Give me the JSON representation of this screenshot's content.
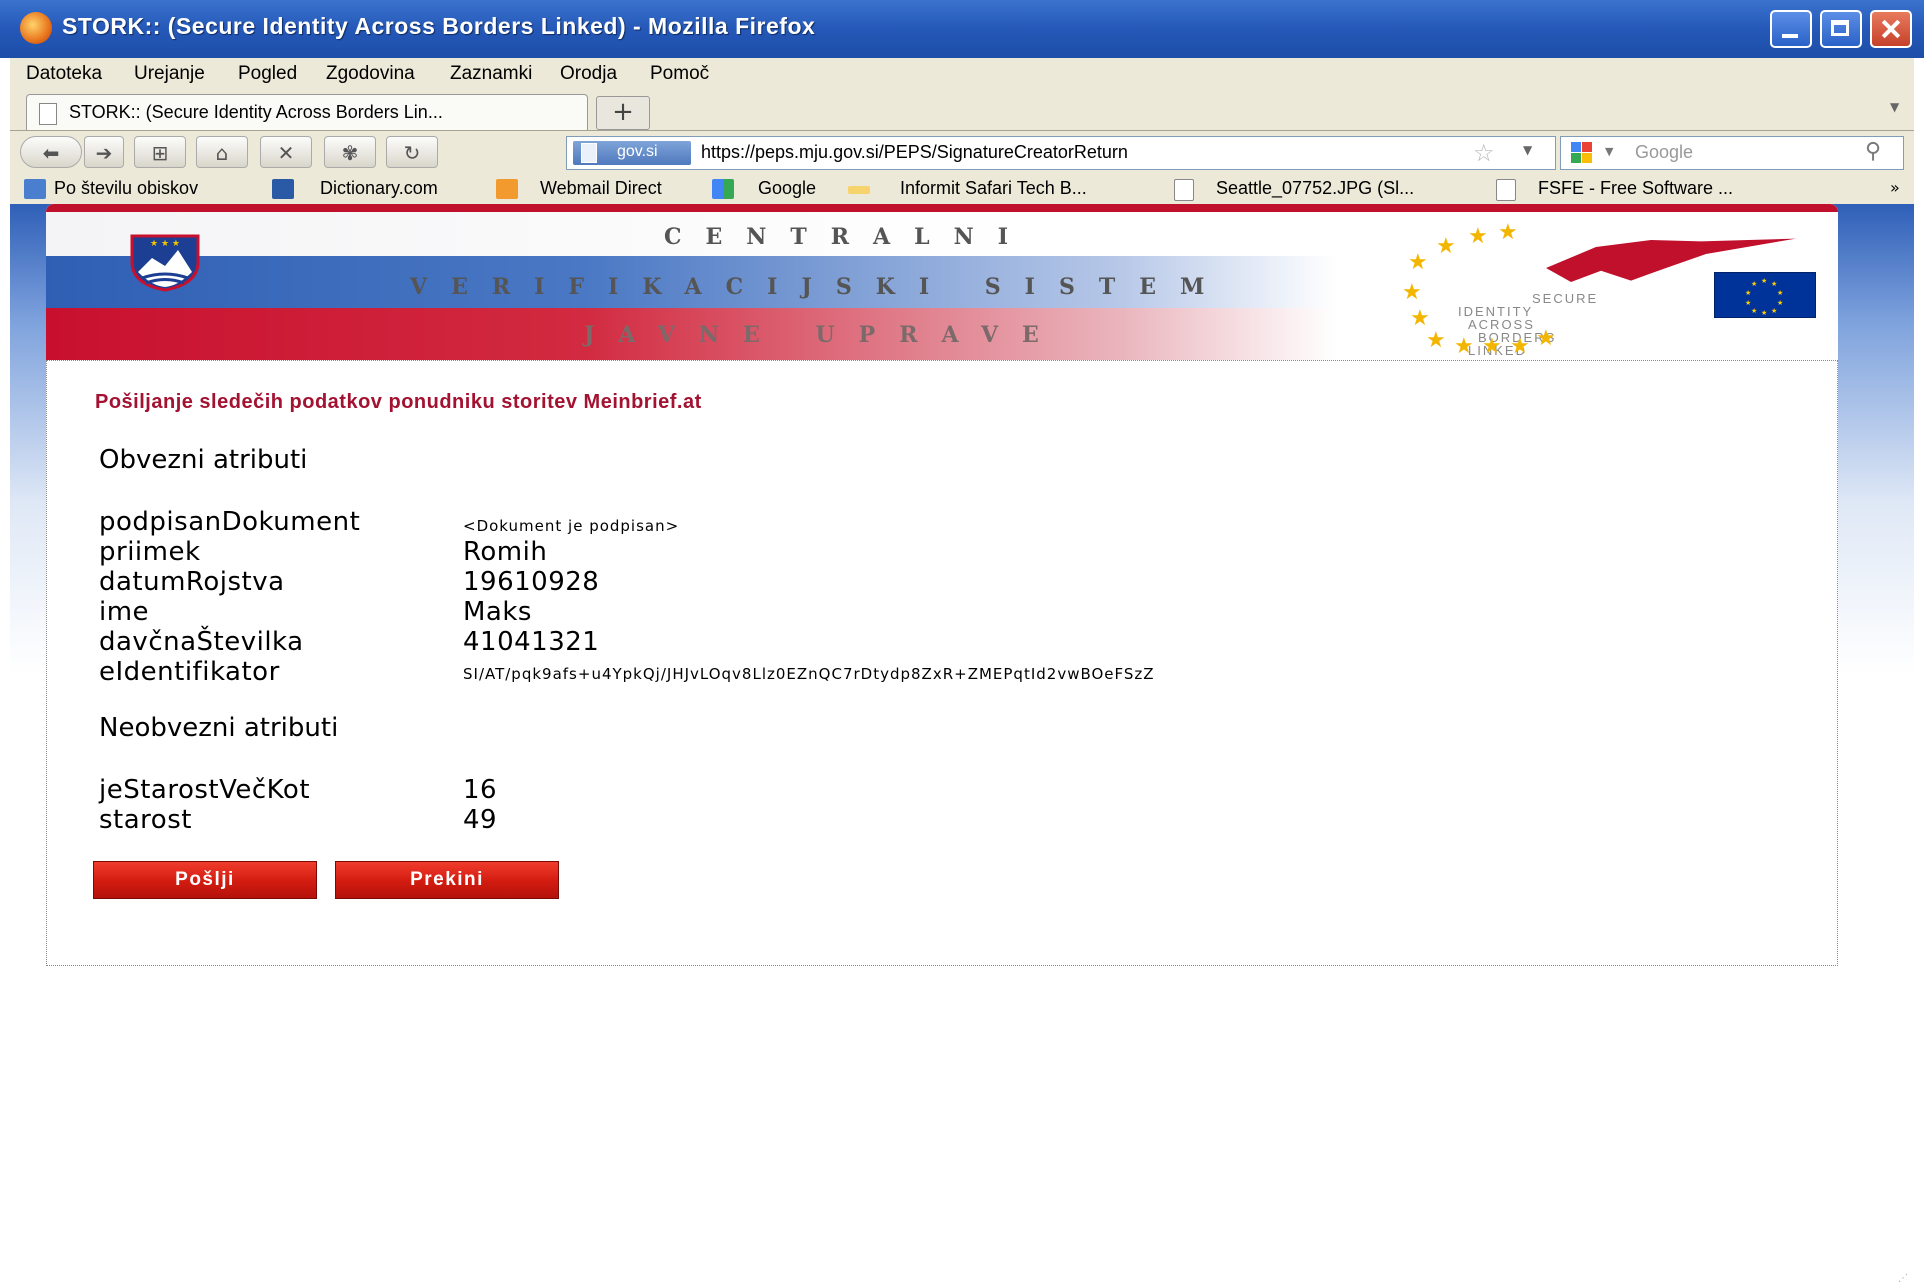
{
  "window": {
    "title": "STORK:: (Secure Identity Across Borders Linked) - Mozilla Firefox"
  },
  "menubar": [
    "Datoteka",
    "Urejanje",
    "Pogled",
    "Zgodovina",
    "Zaznamki",
    "Orodja",
    "Pomoč"
  ],
  "tab": {
    "label": "STORK:: (Secure Identity Across Borders Lin...",
    "new_tab": "+"
  },
  "navbar": {
    "site_badge": "gov.si",
    "url": "https://peps.mju.gov.si/PEPS/SignatureCreatorReturn",
    "search_placeholder": "Google"
  },
  "bookmarks": [
    "Po številu obiskov",
    "Dictionary.com",
    "Webmail Direct",
    "Google",
    "Informit Safari Tech B...",
    "Seattle_07752.JPG (Sl...",
    "FSFE - Free Software ..."
  ],
  "bookmarks_more": "»",
  "banner": {
    "line1": "CENTRALNI",
    "line2": "VERIFIKACIJSKI SISTEM",
    "line3": "JAVNE UPRAVE",
    "stork_text": [
      "SECURE",
      "IDENTITY",
      "ACROSS",
      "BORDERS",
      "LINKED"
    ]
  },
  "page": {
    "notice": "Pošiljanje sledečih podatkov ponudniku storitev Meinbrief.at",
    "mandatory_heading": "Obvezni atributi",
    "mandatory": [
      {
        "name": "podpisanDokument",
        "value": "<Dokument je podpisan>"
      },
      {
        "name": "priimek",
        "value": "Romih"
      },
      {
        "name": "datumRojstva",
        "value": "19610928"
      },
      {
        "name": "ime",
        "value": "Maks"
      },
      {
        "name": "davčnaŠtevilka",
        "value": "41041321"
      },
      {
        "name": "eIdentifikator",
        "value": "SI/AT/pqk9afs+u4YpkQj/JHJvLOqv8Llz0EZnQC7rDtydp8ZxR+ZMEPqtId2vwBOeFSzZ"
      }
    ],
    "optional_heading": "Neobvezni atributi",
    "optional": [
      {
        "name": "jeStarostVečKot",
        "value": "16"
      },
      {
        "name": "starost",
        "value": "49"
      }
    ],
    "send_label": "Pošlji",
    "cancel_label": "Prekini"
  }
}
